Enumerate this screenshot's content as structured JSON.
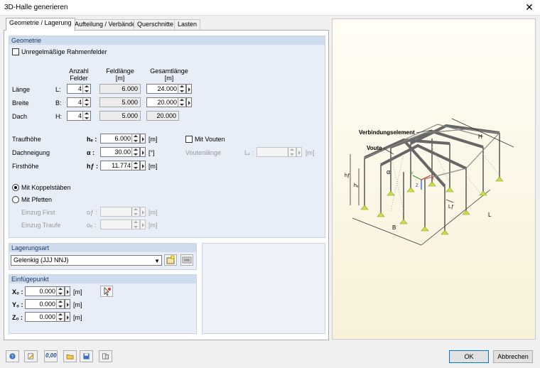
{
  "window": {
    "title": "3D-Halle generieren"
  },
  "tabs": [
    {
      "label": "Geometrie / Lagerung"
    },
    {
      "label": "Aufteilung / Verbände"
    },
    {
      "label": "Querschnitte"
    },
    {
      "label": "Lasten"
    }
  ],
  "geometrie": {
    "header": "Geometrie",
    "irregular_label": "Unregelmäßige Rahmenfelder",
    "col_anzahl": "Anzahl\nFelder",
    "col_feld": "Feldlänge\n[m]",
    "col_gesamt": "Gesamtlänge\n[m]",
    "rows": [
      {
        "name": "Länge",
        "sym": "L:",
        "anzahl": "4",
        "feld": "6.000",
        "gesamt": "24.000"
      },
      {
        "name": "Breite",
        "sym": "B:",
        "anzahl": "4",
        "feld": "5.000",
        "gesamt": "20.000"
      },
      {
        "name": "Dach",
        "sym": "H:",
        "anzahl": "4",
        "feld": "5.000",
        "gesamt": "20.000"
      }
    ],
    "traufhoehe_label": "Traufhöhe",
    "traufhoehe_sym": "hₑ :",
    "traufhoehe_val": "6.000",
    "traufhoehe_unit": "[m]",
    "dachneigung_label": "Dachneigung",
    "dachneigung_sym": "α :",
    "dachneigung_val": "30.00",
    "dachneigung_unit": "[°]",
    "firsthoehe_label": "Firsthöhe",
    "firsthoehe_sym": "hƒ :",
    "firsthoehe_val": "11.774",
    "firsthoehe_unit": "[m]",
    "voute_label": "Mit Vouten",
    "voutenlaenge_label": "Voutenlänge",
    "voutenlaenge_sym": "Lᵥ :",
    "voutenlaenge_unit": "[m]",
    "koppel_label": "Mit Koppelstäben",
    "pfetten_label": "Mit Pfetten",
    "einzug_first_label": "Einzug First",
    "einzug_first_sym": "oƒ :",
    "einzug_first_unit": "[m]",
    "einzug_traufe_label": "Einzug Traufe",
    "einzug_traufe_sym": "oₑ :",
    "einzug_traufe_unit": "[m]"
  },
  "lagerung": {
    "header": "Lagerungsart",
    "value": "Gelenkig (JJJ NNJ)"
  },
  "einfuege": {
    "header": "Einfügepunkt",
    "rows": [
      {
        "sym": "X₀ :",
        "val": "0.000",
        "unit": "[m]"
      },
      {
        "sym": "Y₀ :",
        "val": "0.000",
        "unit": "[m]"
      },
      {
        "sym": "Z₀ :",
        "val": "0.000",
        "unit": "[m]"
      }
    ]
  },
  "preview": {
    "label_verbindung": "Verbindungselement",
    "label_voute": "Voute",
    "label_H": "H",
    "label_L": "L",
    "label_B": "B",
    "label_Lf": "Lƒ",
    "label_hf": "hƒ",
    "label_he": "hₑ",
    "label_alpha": "α",
    "label_X": "X",
    "label_Y": "Y",
    "label_Z": "Z"
  },
  "footer": {
    "ok_label": "OK",
    "cancel_label": "Abbrechen",
    "tool_zero_label": "0,00"
  }
}
